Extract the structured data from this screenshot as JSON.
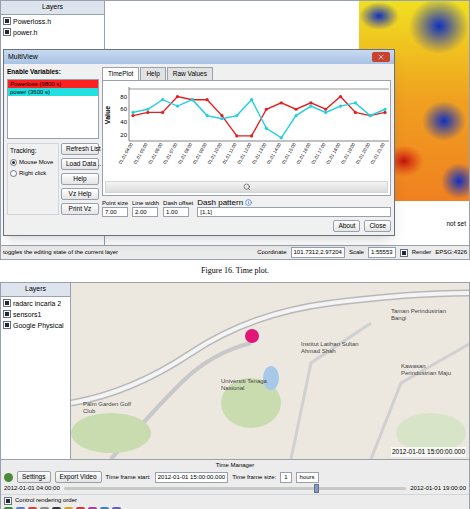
{
  "figure_top": {
    "layers_panel": {
      "title": "Layers",
      "items": [
        {
          "label": "Powerloss.h",
          "checked": true
        },
        {
          "label": "power.h",
          "checked": true
        }
      ]
    },
    "dialog": {
      "title": "MultiView",
      "enable_label": "Enable Variables:",
      "variables": [
        {
          "label": "Powerloss (9800 s)",
          "color": "#ff2020"
        },
        {
          "label": "power (3600 s)",
          "color": "#22e0e0"
        }
      ],
      "tracking_label": "Tracking:",
      "tracking": [
        {
          "label": "Mouse Move",
          "selected": true
        },
        {
          "label": "Right click",
          "selected": false
        }
      ],
      "side_buttons": [
        "Refresh List",
        "Load Data ...",
        "Help",
        "Vz Help",
        "Print Vz"
      ],
      "tabs": [
        {
          "label": "TimePlot",
          "selected": true
        },
        {
          "label": "Help",
          "selected": false
        },
        {
          "label": "Raw Values",
          "selected": false
        }
      ],
      "chart": {
        "y_label": "Value",
        "y_ticks": [
          "80",
          "60",
          "40",
          "20"
        ],
        "y_min": 10,
        "y_max": 95,
        "x_ticks": [
          "01.01 04:00",
          "01.01 05:00",
          "01.01 06:00",
          "01.01 07:00",
          "01.01 08:00",
          "01.01 09:00",
          "01.01 10:00",
          "01.01 11:00",
          "01.01 12:00",
          "01.01 13:00",
          "01.01 14:00",
          "01.01 15:00",
          "01.01 16:00",
          "01.01 17:00",
          "01.01 18:00",
          "01.01 19:00",
          "01.01 20:00",
          "01.01 21:00"
        ],
        "series": [
          {
            "name": "Powerloss",
            "color": "#e02020",
            "values": [
              50,
              55,
              55,
              80,
              75,
              75,
              50,
              18,
              18,
              60,
              70,
              60,
              70,
              60,
              80,
              55,
              50,
              55
            ]
          },
          {
            "name": "power",
            "color": "#20d0e0",
            "values": [
              55,
              60,
              75,
              65,
              75,
              50,
              45,
              50,
              75,
              30,
              15,
              50,
              65,
              55,
              65,
              70,
              50,
              60
            ]
          }
        ]
      },
      "controls": [
        {
          "label": "Point size",
          "value": "7.00"
        },
        {
          "label": "Line width",
          "value": "2.00"
        },
        {
          "label": "Dash offset",
          "value": "1.00"
        }
      ],
      "dash_pattern": {
        "label": "Dash pattern",
        "value": "[1,1]"
      },
      "buttons": [
        "About",
        "Close"
      ]
    },
    "right_panel_text": "not set",
    "status_bar": {
      "hint": "toggles the editing state of the current layer",
      "coordinate_label": "Coordinate",
      "coordinate": "101.7312,2.97204",
      "scale_label": "Scale",
      "scale": "1:55553",
      "render_label": "Render",
      "render_checked": true,
      "crs": "EPSG:4326"
    }
  },
  "caption": "Figure 16. Time plot.",
  "figure_bottom": {
    "layers_panel": {
      "title": "Layers",
      "items": [
        {
          "label": "radarc incarla 2",
          "checked": true
        },
        {
          "label": "sensors1",
          "checked": true
        },
        {
          "label": "Google Physical",
          "checked": true
        }
      ]
    },
    "map": {
      "labels": [
        "Palm Garden Golf Club",
        "Universiti Tenaga Nasional",
        "Institut Latihan Sultan Ahmad Shah",
        "Taman Perindustrian Bangi",
        "Kawasan Perindustrian Maju"
      ],
      "timestamp": "2012-01-01 15:00:00.000",
      "marker_color": "#e0167a"
    },
    "time_manager": {
      "title": "Time Manager",
      "settings": "Settings",
      "export": "Export Video",
      "start_label": "Time frame start:",
      "start": "2012-01-01 15:00:00.000",
      "size_label": "Time frame size:",
      "size": "1",
      "unit": "hours",
      "range_start": "2012-01-01 04:00:00",
      "range_end": "2012-01-01 19:00:00",
      "level": 0.73
    },
    "status": {
      "hint": "Control rendering order",
      "checked": true
    }
  }
}
